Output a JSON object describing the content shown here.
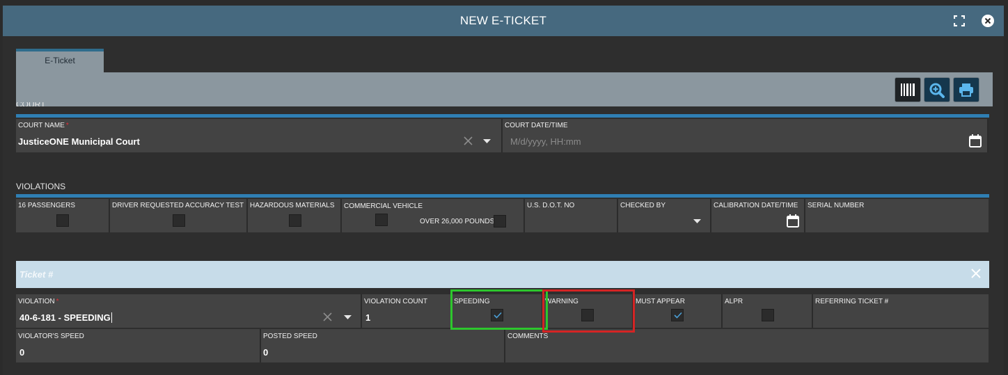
{
  "window": {
    "title": "NEW E-TICKET"
  },
  "tabs": [
    {
      "label": "E-Ticket"
    }
  ],
  "toolbar": {
    "buttons": [
      "barcode-icon",
      "zoom-in-icon",
      "print-icon"
    ]
  },
  "court": {
    "section_label": "COURT",
    "court_name_label": "COURT NAME",
    "court_name_value": "JusticeONE Municipal Court",
    "court_datetime_label": "COURT DATE/TIME",
    "court_datetime_placeholder": "M/d/yyyy, HH:mm"
  },
  "violations": {
    "section_label": "VIOLATIONS",
    "passengers_label": "16 PASSENGERS",
    "accuracy_label": "DRIVER REQUESTED ACCURACY TEST",
    "hazmat_label": "HAZARDOUS MATERIALS",
    "commercial_label": "COMMERCIAL VEHICLE",
    "over_weight_label": "OVER 26,000 POUNDS",
    "dot_label": "U.S. D.O.T. NO",
    "checked_by_label": "CHECKED BY",
    "calibration_label": "CALIBRATION DATE/TIME",
    "serial_label": "SERIAL NUMBER"
  },
  "ticket": {
    "header_label": "Ticket #",
    "violation_label": "VIOLATION",
    "violation_value": "40-6-181 - SPEEDING",
    "count_label": "VIOLATION COUNT",
    "count_value": "1",
    "speeding_label": "SPEEDING",
    "speeding_checked": true,
    "warning_label": "WARNING",
    "warning_checked": false,
    "must_appear_label": "MUST APPEAR",
    "must_appear_checked": true,
    "alpr_label": "ALPR",
    "alpr_checked": false,
    "referring_label": "REFERRING TICKET #",
    "violator_speed_label": "VIOLATOR'S SPEED",
    "violator_speed_value": "0",
    "posted_speed_label": "POSTED SPEED",
    "posted_speed_value": "0",
    "comments_label": "COMMENTS"
  },
  "colors": {
    "title_bar": "#46697f",
    "section_accent": "#2f7fb4",
    "required": "#e0303a",
    "highlight_green": "#2dc72d",
    "highlight_red": "#d42424"
  }
}
